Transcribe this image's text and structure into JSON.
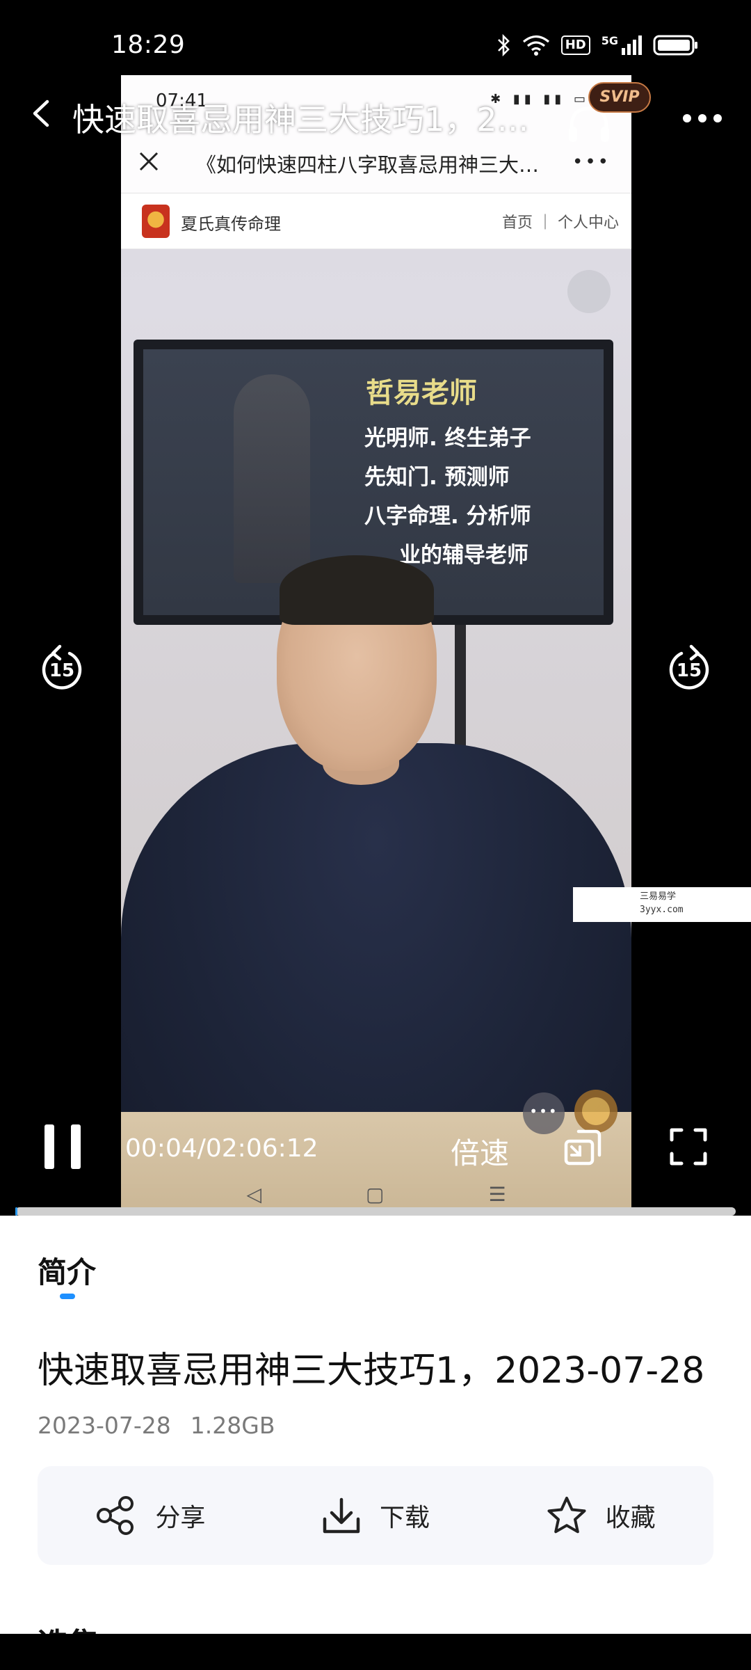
{
  "status_bar": {
    "time": "18:29",
    "hd_label": "HD",
    "network_label": "5G"
  },
  "player": {
    "title": "快速取喜忌用神三大技巧1，2…",
    "svip_label": "SVIP",
    "current_time": "00:04",
    "duration": "02:06:12",
    "time_readout": "00:04/02:06:12",
    "speed_label": "倍速",
    "skip_seconds": "15",
    "progress_fraction": 0.0005,
    "accent_color": "#2a9bf2"
  },
  "video_content": {
    "inner_status_time": "07:41",
    "inner_title": "《如何快速四柱八字取喜忌用神三大…",
    "inner_site_name": "夏氏真传命理",
    "inner_links": "首页 ｜ 个人中心",
    "monitor_title": "哲易老师",
    "monitor_lines": [
      "光明师. 终生弟子",
      "先知门. 预测师",
      "八字命理. 分析师",
      "业的辅导老师"
    ],
    "watermark_line1": "三易易学",
    "watermark_line2": "3yyx.com",
    "inner_nav_back": "◁",
    "inner_nav_home": "▢",
    "inner_nav_menu": "☰"
  },
  "details": {
    "tab_label": "简介",
    "title": "快速取喜忌用神三大技巧1，2023-07-28",
    "date": "2023-07-28",
    "size": "1.28GB",
    "actions": {
      "share": "分享",
      "download": "下载",
      "favorite": "收藏"
    },
    "next_section_label": "选集"
  }
}
